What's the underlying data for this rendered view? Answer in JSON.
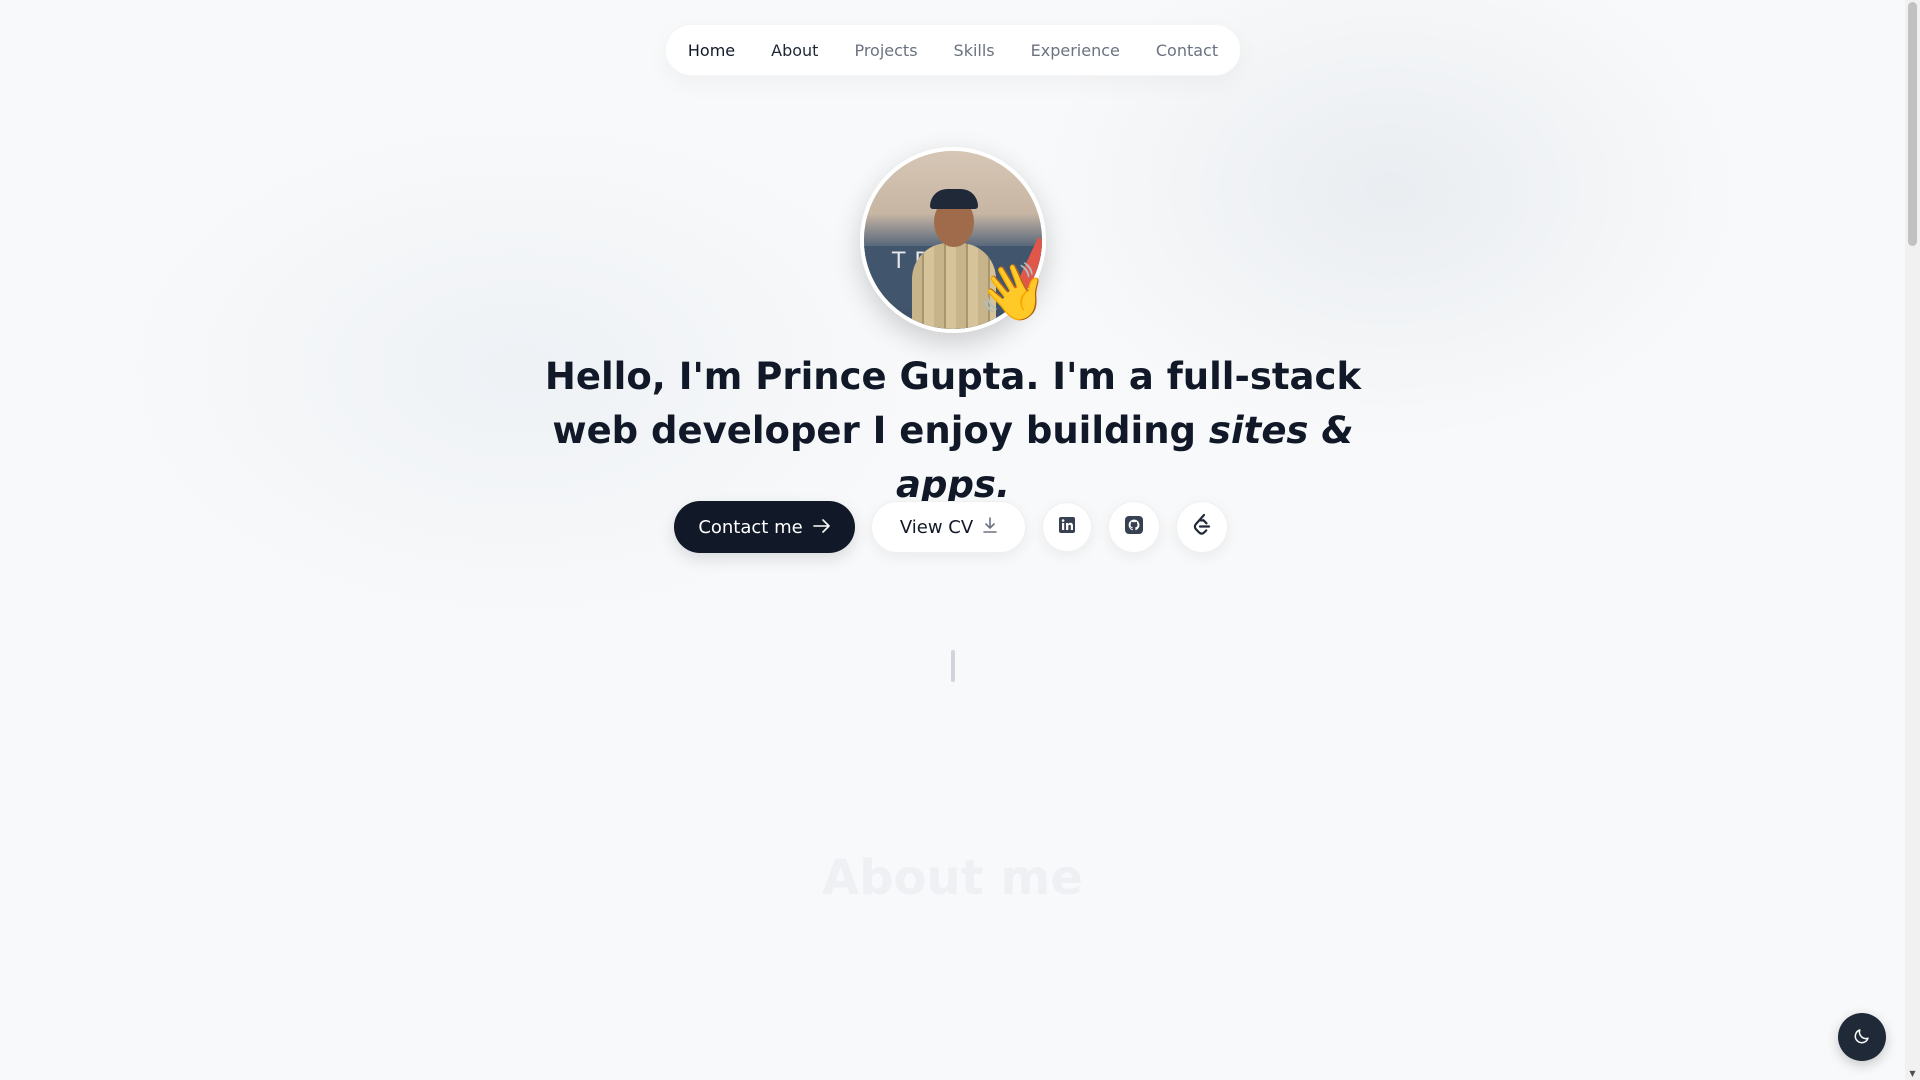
{
  "nav": {
    "items": [
      {
        "label": "Home"
      },
      {
        "label": "About"
      },
      {
        "label": "Projects"
      },
      {
        "label": "Skills"
      },
      {
        "label": "Experience"
      },
      {
        "label": "Contact"
      }
    ]
  },
  "avatar": {
    "wave_emoji": "👋",
    "banner_text": "T   DS"
  },
  "hero": {
    "part1_bold": "Hello, I'm Prince Gupta.",
    "part2": " I'm a ",
    "part3_bold": "full-stack web developer",
    "part4": " I enjoy building ",
    "part5_italic": "sites & apps."
  },
  "buttons": {
    "contact_label": "Contact me",
    "cv_label": "View CV"
  },
  "icons": {
    "social": [
      "linkedin-icon",
      "github-icon",
      "leetcode-icon"
    ],
    "theme": "moon-icon"
  },
  "sections": {
    "about_title": "About me"
  },
  "colors": {
    "primary": "#111827",
    "background": "#f8f9fa",
    "muted": "#6b7280"
  }
}
